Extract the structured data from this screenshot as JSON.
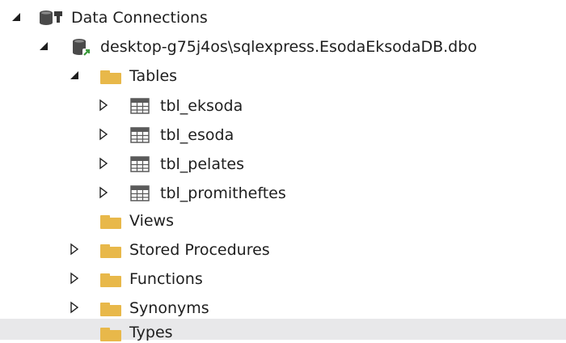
{
  "server_explorer": {
    "nodes": [
      {
        "label": "Data Connections",
        "icon": "data-connections-icon",
        "state": "expanded"
      },
      {
        "label": "desktop-g75j4os\\sqlexpress.EsodaEksodaDB.dbo",
        "icon": "database-connection-icon",
        "state": "expanded"
      },
      {
        "label": "Tables",
        "icon": "folder-icon",
        "state": "expanded"
      },
      {
        "label": "tbl_eksoda",
        "icon": "table-icon",
        "state": "collapsed"
      },
      {
        "label": "tbl_esoda",
        "icon": "table-icon",
        "state": "collapsed"
      },
      {
        "label": "tbl_pelates",
        "icon": "table-icon",
        "state": "collapsed"
      },
      {
        "label": "tbl_promitheftes",
        "icon": "table-icon",
        "state": "collapsed"
      },
      {
        "label": "Views",
        "icon": "folder-icon",
        "state": "leaf"
      },
      {
        "label": "Stored Procedures",
        "icon": "folder-icon",
        "state": "collapsed"
      },
      {
        "label": "Functions",
        "icon": "folder-icon",
        "state": "collapsed"
      },
      {
        "label": "Synonyms",
        "icon": "folder-icon",
        "state": "collapsed"
      },
      {
        "label": "Types",
        "icon": "folder-icon",
        "state": "leaf"
      }
    ]
  },
  "colors": {
    "folder": "#e8b84a",
    "table_grid": "#5a5a5a",
    "database": "#4a4a4a",
    "connection_plug": "#3c9a3c",
    "highlight": "#e8e8ea",
    "text": "#1e1e1e"
  }
}
